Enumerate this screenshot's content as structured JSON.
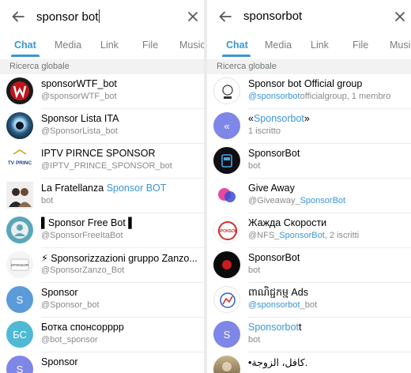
{
  "left": {
    "query": "sponsor bot",
    "tabs": [
      "Chat",
      "Media",
      "Link",
      "File",
      "Musica"
    ],
    "section": "Ricerca globale",
    "results": [
      {
        "name": "sponsorWTF_bot",
        "sub": "@sponsorWTF_bot"
      },
      {
        "name": "Sponsor Lista ITA",
        "sub": "@SponsorLista_bot"
      },
      {
        "name": "IPTV PIRNCE SPONSOR",
        "sub": "@IPTV_PRINCE_SPONSOR_bot",
        "avatar_text": "TV PRINC"
      },
      {
        "name_pre": "La Fratellanza ",
        "name_hl": "Sponsor BOT",
        "sub": "bot"
      },
      {
        "name": "▌Sponsor Free Bot ▌",
        "sub": "@SponsorFreeItaBot"
      },
      {
        "name": "⚡ Sponsorizzazioni gruppo Zanzo...",
        "sub": "@SponsorZanzo_Bot",
        "avatar_text": "SPONSOR"
      },
      {
        "name": "Sponsor",
        "sub": "@Sponsor_bot",
        "avatar_letter": "S"
      },
      {
        "name": "Ботка спонсорррр",
        "sub": "@bot_sponsor",
        "avatar_letter": "БС"
      },
      {
        "name": "Sponsor",
        "sub": "",
        "avatar_letter": "S"
      }
    ]
  },
  "right": {
    "query": "sponsorbot",
    "tabs": [
      "Chat",
      "Media",
      "Link",
      "File",
      "Musica"
    ],
    "section": "Ricerca globale",
    "results": [
      {
        "name": "Sponsor bot Official group",
        "sub_hl": "@sponsorbot",
        "sub_post": "officialgroup, 1 membro"
      },
      {
        "name_pre": "«",
        "name_hl": "Sponsorbot",
        "name_post": "»",
        "sub": "1 iscritto",
        "avatar_letter": "«"
      },
      {
        "name_hl": "SponsorBot",
        "sub": "bot"
      },
      {
        "name": "Give Away",
        "sub_pre": "@Giveaway_",
        "sub_hl": "SponsorBot"
      },
      {
        "name": "Жажда Скорости",
        "sub_pre": "@NFS_",
        "sub_hl": "SponsorBot",
        "sub_post": ", 2 iscritti",
        "avatar_text": "SPONSOR"
      },
      {
        "name_hl": "SponsorBot",
        "sub": "bot"
      },
      {
        "name": "ពាណិជ្ជកម្ម Ads",
        "sub_hl": "@sponsorbot",
        "sub_post": "_bot"
      },
      {
        "name_hl": "Sponsorbot",
        "name_post": "t",
        "sub": "bot",
        "avatar_letter": "S"
      },
      {
        "name": "•کافل، الزوجة.",
        "sub": ""
      }
    ]
  },
  "colors": {
    "accent": "#3a95d6",
    "purple_avatar": "#7e86e8",
    "cyan_avatar": "#4fb9d4"
  }
}
